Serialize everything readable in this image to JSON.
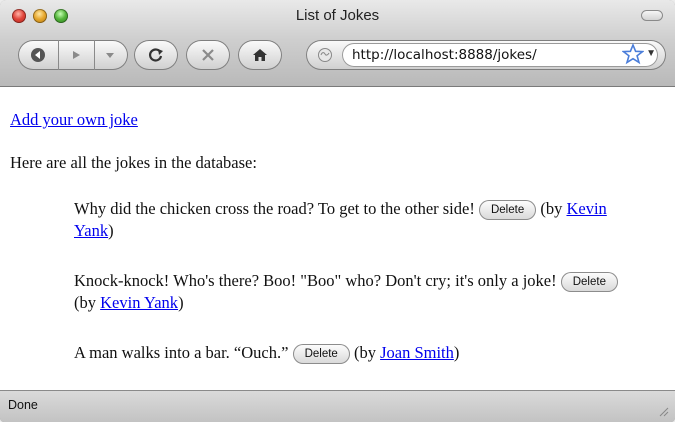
{
  "window": {
    "title": "List of Jokes"
  },
  "toolbar": {
    "url": "http://localhost:8888/jokes/",
    "icons": [
      "back-icon",
      "forward-icon",
      "history-dropdown-icon",
      "reload-icon",
      "stop-icon",
      "home-icon",
      "site-icon",
      "bookmark-star-icon",
      "url-dropdown-icon"
    ]
  },
  "content": {
    "add_link": "Add your own joke",
    "intro": "Here are all the jokes in the database:",
    "jokes": [
      {
        "text": "Why did the chicken cross the road? To get to the other side!",
        "delete_label": "Delete",
        "by_prefix": "(by",
        "author": "Kevin Yank",
        "by_suffix": ")"
      },
      {
        "text": "Knock-knock! Who's there? Boo! \"Boo\" who? Don't cry; it's only a joke!",
        "delete_label": "Delete",
        "by_prefix": "(by",
        "author": "Kevin Yank",
        "by_suffix": ")"
      },
      {
        "text": "A man walks into a bar. “Ouch.”",
        "delete_label": "Delete",
        "by_prefix": "(by",
        "author": "Joan Smith",
        "by_suffix": ")"
      }
    ]
  },
  "status": {
    "text": "Done"
  },
  "colors": {
    "link": "#0000ee",
    "text": "#111111"
  }
}
